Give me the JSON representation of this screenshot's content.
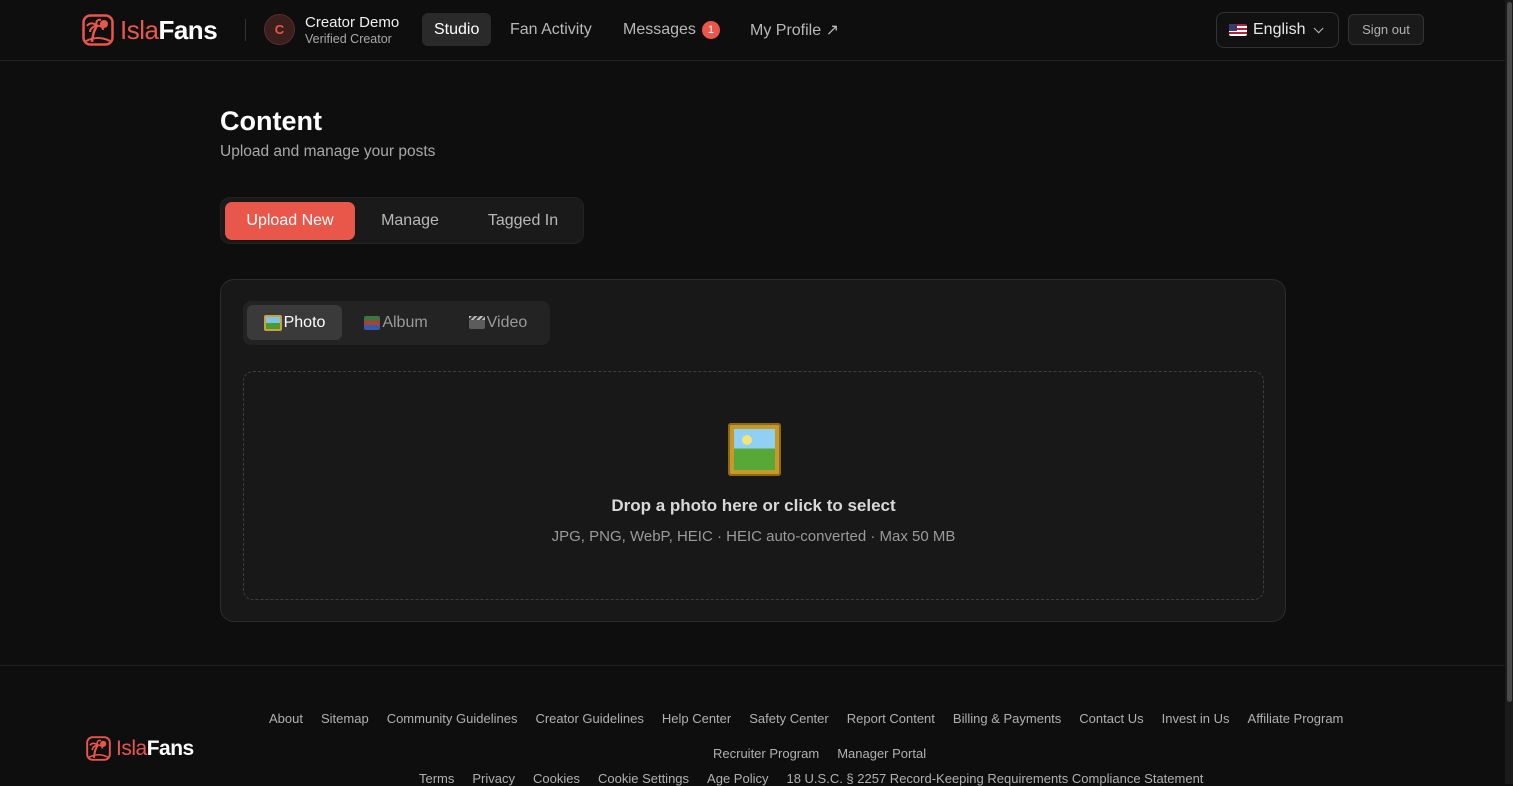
{
  "brand": {
    "isla": "Isla",
    "fans": "Fans"
  },
  "user": {
    "initial": "C",
    "name": "Creator Demo",
    "status": "Verified Creator"
  },
  "nav": {
    "studio": "Studio",
    "fan_activity": "Fan Activity",
    "messages": "Messages",
    "messages_badge": "1",
    "my_profile": "My Profile ↗"
  },
  "language": {
    "selected": "English",
    "flag_icon": "us-flag-icon"
  },
  "sign_out": "Sign out",
  "page": {
    "title": "Content",
    "subtitle": "Upload and manage your posts"
  },
  "tabs": {
    "upload": "Upload New",
    "manage": "Manage",
    "tagged": "Tagged In"
  },
  "upload_types": {
    "photo": "Photo",
    "album": "Album",
    "video": "Video"
  },
  "dropzone": {
    "title": "Drop a photo here or click to select",
    "formats": "JPG, PNG, WebP, HEIC · HEIC auto-converted · Max 50 MB"
  },
  "footer": {
    "links_row1": [
      "About",
      "Sitemap",
      "Community Guidelines",
      "Creator Guidelines",
      "Help Center",
      "Safety Center",
      "Report Content",
      "Billing & Payments",
      "Contact Us",
      "Invest in Us",
      "Affiliate Program"
    ],
    "links_row2": [
      "Recruiter Program",
      "Manager Portal"
    ],
    "links_row3": [
      "Terms",
      "Privacy",
      "Cookies",
      "Cookie Settings",
      "Age Policy",
      "18 U.S.C. § 2257 Record-Keeping Requirements Compliance Statement"
    ]
  },
  "colors": {
    "accent": "#e8574a",
    "background": "#0e0e0e",
    "card": "#181818"
  }
}
